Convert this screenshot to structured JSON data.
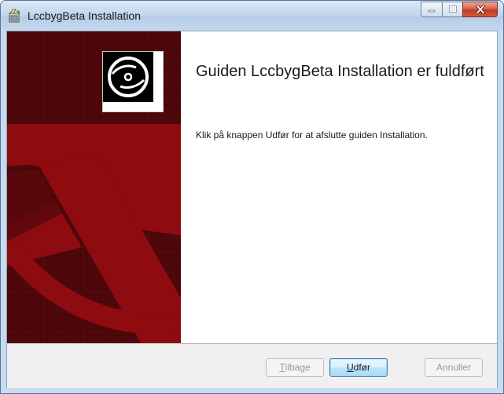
{
  "window": {
    "title": "LccbygBeta Installation",
    "app_icon": "installer-icon",
    "controls": [
      "minimize-icon",
      "maximize-icon",
      "close-icon"
    ]
  },
  "banner": {
    "icon": "cd-disc-icon",
    "colors": {
      "background": "#58080c",
      "anchor": "#8e0b10"
    }
  },
  "content": {
    "heading": "Guiden LccbygBeta Installation er fuldført",
    "message": "Klik på knappen Udfør for at afslutte guiden Installation."
  },
  "buttons": {
    "back": {
      "label_mnemonic": "T",
      "label_rest": "ilbage",
      "enabled": false
    },
    "finish": {
      "label_mnemonic": "U",
      "label_rest": "dfør",
      "enabled": true,
      "default": true
    },
    "cancel": {
      "label": "Annuller",
      "enabled": false
    }
  }
}
